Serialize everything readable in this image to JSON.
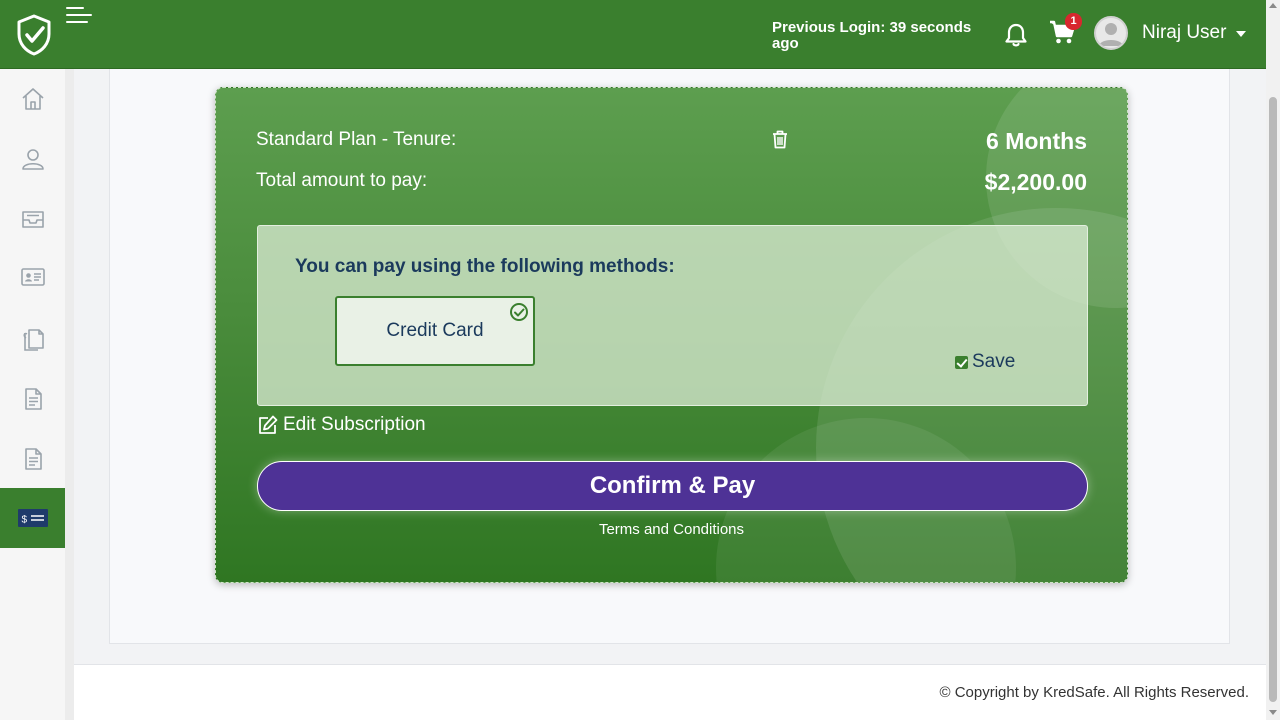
{
  "header": {
    "previous_login": "Previous Login: 39 seconds ago",
    "cart_count": "1",
    "user_name": "Niraj User",
    "logo_icon": "shield-check-icon"
  },
  "sidebar": {
    "items": [
      {
        "name": "home-icon",
        "active": false
      },
      {
        "name": "user-icon",
        "active": false
      },
      {
        "name": "inbox-icon",
        "active": false
      },
      {
        "name": "id-card-icon",
        "active": false
      },
      {
        "name": "documents-icon",
        "active": false
      },
      {
        "name": "file-icon",
        "active": false
      },
      {
        "name": "file-text-icon",
        "active": false
      },
      {
        "name": "billing-icon",
        "active": true
      }
    ]
  },
  "subscription": {
    "plan_label": "Standard Plan - Tenure:",
    "tenure": "6 Months",
    "total_label": "Total amount to pay:",
    "total_amount": "$2,200.00",
    "methods_title": "You can pay using the following methods:",
    "method": "Credit Card",
    "method_selected": true,
    "save_label": "Save",
    "save_checked": true,
    "edit_label": "Edit Subscription",
    "confirm_label": "Confirm & Pay",
    "terms_label": "Terms and Conditions"
  },
  "footer": {
    "copyright": "© Copyright by KredSafe. All Rights Reserved."
  },
  "colors": {
    "brand_green": "#3a7f2e",
    "confirm_purple": "#4e3296",
    "badge_red": "#d8272e"
  }
}
